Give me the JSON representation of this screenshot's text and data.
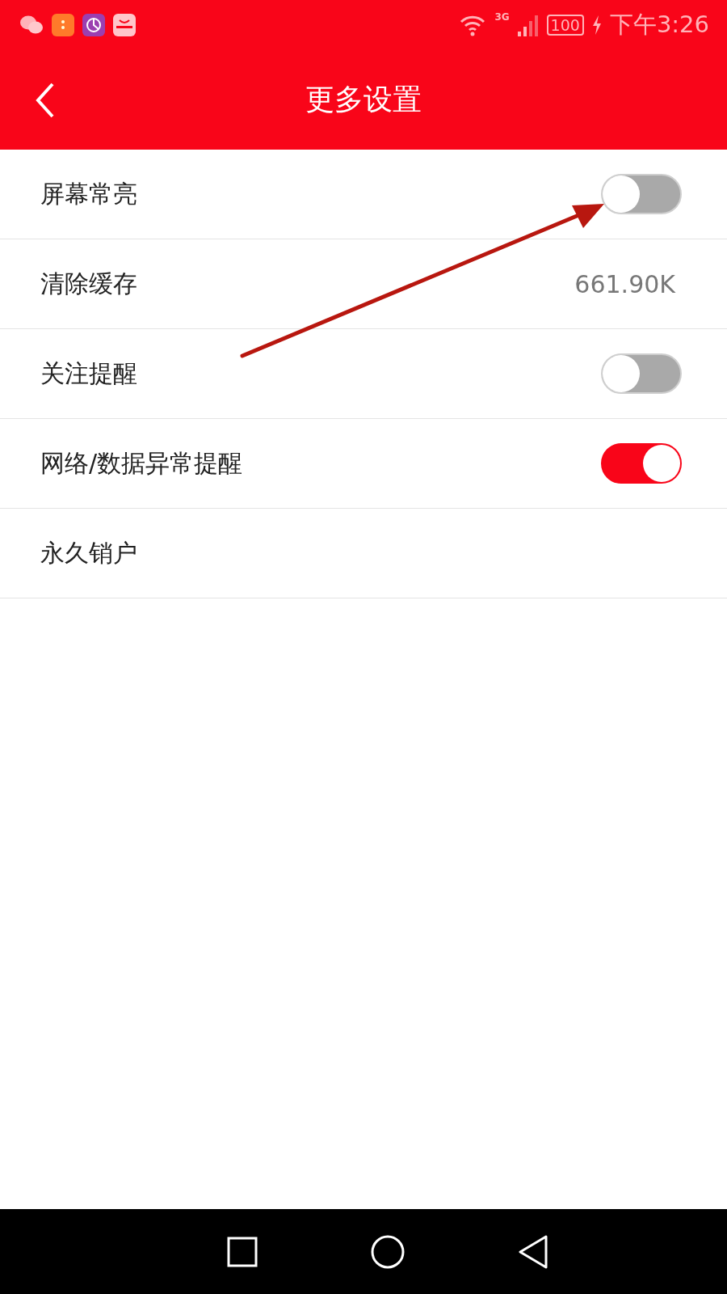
{
  "status_bar": {
    "network": "3G",
    "battery": "100",
    "time": "下午3:26"
  },
  "header": {
    "title": "更多设置"
  },
  "settings": [
    {
      "kind": "toggle",
      "label": "屏幕常亮",
      "on": false
    },
    {
      "kind": "value",
      "label": "清除缓存",
      "value": "661.90K"
    },
    {
      "kind": "toggle",
      "label": "关注提醒",
      "on": false
    },
    {
      "kind": "toggle",
      "label": "网络/数据异常提醒",
      "on": true
    },
    {
      "kind": "plain",
      "label": "永久销户"
    }
  ]
}
